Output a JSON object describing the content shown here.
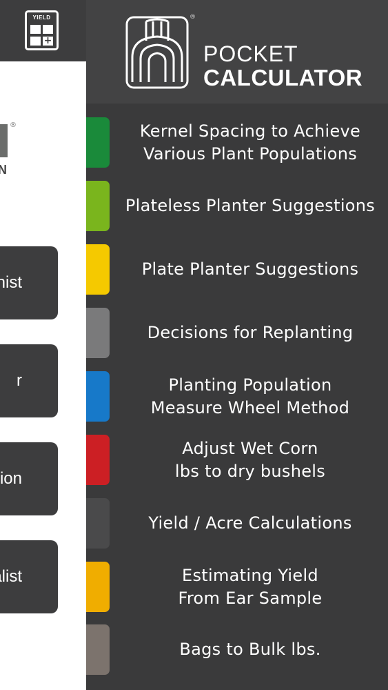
{
  "left_panel": {
    "header_icon": {
      "name": "yield-calculator-icon",
      "label": "YIELD",
      "symbol": "+"
    },
    "logo": {
      "text": "N",
      "registered": "®"
    },
    "buttons": [
      {
        "label": "nist"
      },
      {
        "label": "r"
      },
      {
        "label": "gion"
      },
      {
        "label": "ialist"
      }
    ]
  },
  "drawer": {
    "registered": "®",
    "title_line1": "POCKET",
    "title_line2": "CALCULATOR",
    "menu": [
      {
        "lines": [
          "Kernel Spacing to Achieve",
          "Various Plant Populations"
        ],
        "color": "#1a8a3a"
      },
      {
        "lines": [
          "Plateless Planter Suggestions"
        ],
        "color": "#7ab51d"
      },
      {
        "lines": [
          "Plate Planter Suggestions"
        ],
        "color": "#f5c900"
      },
      {
        "lines": [
          "Decisions for Replanting"
        ],
        "color": "#7a7a7b"
      },
      {
        "lines": [
          "Planting Population",
          "Measure Wheel Method"
        ],
        "color": "#1779c9"
      },
      {
        "lines": [
          "Adjust Wet Corn",
          "lbs to dry bushels"
        ],
        "color": "#cc1f24"
      },
      {
        "lines": [
          "Yield / Acre Calculations"
        ],
        "color": "#4a4a4b"
      },
      {
        "lines": [
          "Estimating Yield",
          "From Ear Sample"
        ],
        "color": "#f0ad00"
      },
      {
        "lines": [
          "Bags to Bulk lbs."
        ],
        "color": "#7c736d"
      }
    ]
  }
}
